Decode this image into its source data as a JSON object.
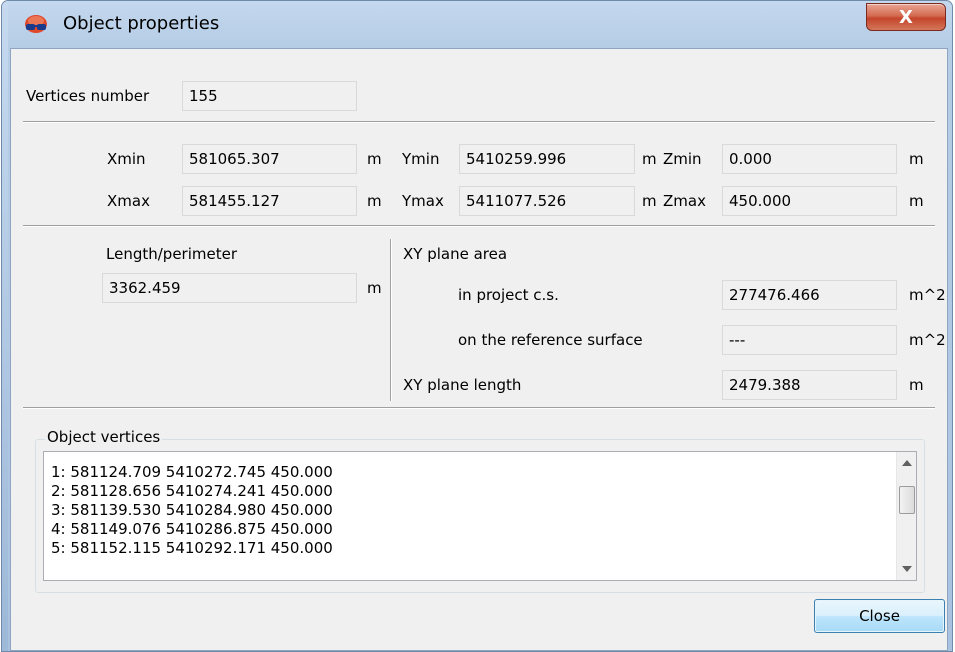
{
  "window": {
    "title": "Object properties",
    "close_glyph": "X",
    "app_icon": "3d-glasses-icon"
  },
  "vertices": {
    "label": "Vertices number",
    "value": "155"
  },
  "extents": {
    "xmin_label": "Xmin",
    "xmin_value": "581065.307",
    "xmin_unit": "m",
    "ymin_label": "Ymin",
    "ymin_value": "5410259.996",
    "ymin_unit": "m",
    "zmin_label": "Zmin",
    "zmin_value": "0.000",
    "zmin_unit": "m",
    "xmax_label": "Xmax",
    "xmax_value": "581455.127",
    "xmax_unit": "m",
    "ymax_label": "Ymax",
    "ymax_value": "5411077.526",
    "ymax_unit": "m",
    "zmax_label": "Zmax",
    "zmax_value": "450.000",
    "zmax_unit": "m"
  },
  "length": {
    "label": "Length/perimeter",
    "value": "3362.459",
    "unit": "m"
  },
  "area": {
    "title": "XY plane area",
    "project_label": "in project c.s.",
    "project_value": "277476.466",
    "project_unit": "m^2",
    "surface_label": "on the reference surface",
    "surface_value": "---",
    "surface_unit": "m^2",
    "plane_length_label": "XY plane length",
    "plane_length_value": "2479.388",
    "plane_length_unit": "m"
  },
  "object_vertices": {
    "title": "Object vertices",
    "items": [
      "1: 581124.709 5410272.745 450.000",
      "2: 581128.656 5410274.241 450.000",
      "3: 581139.530 5410284.980 450.000",
      "4: 581149.076 5410286.875 450.000",
      "5: 581152.115 5410292.171 450.000"
    ]
  },
  "buttons": {
    "close_label": "Close"
  }
}
